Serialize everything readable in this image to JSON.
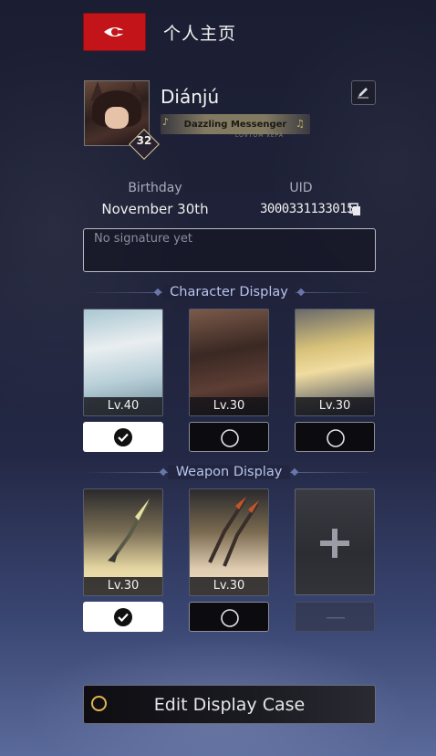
{
  "header": {
    "title": "个人主页"
  },
  "profile": {
    "username": "Diánjú",
    "level": "32",
    "title_badge": "Dazzling Messenger",
    "title_sub": "LOVTOM xEPA"
  },
  "info": {
    "birthday_label": "Birthday",
    "birthday_value": "November 30th",
    "uid_label": "UID",
    "uid_value": "3000331133015"
  },
  "signature": {
    "placeholder": "No signature yet"
  },
  "character_display": {
    "title": "Character Display",
    "cards": [
      {
        "level": "Lv.40",
        "selected": true
      },
      {
        "level": "Lv.30",
        "selected": false
      },
      {
        "level": "Lv.30",
        "selected": false
      }
    ]
  },
  "weapon_display": {
    "title": "Weapon Display",
    "cards": [
      {
        "level": "Lv.30",
        "selected": true
      },
      {
        "level": "Lv.30",
        "selected": false
      },
      {
        "level": "",
        "empty": true
      }
    ]
  },
  "edit_case": {
    "label": "Edit Display Case"
  },
  "icons": {
    "logo": "eye-emblem-icon",
    "edit": "pencil-icon",
    "copy": "copy-icon",
    "selected": "check-circle-icon",
    "unselected": "empty-circle-icon",
    "add": "plus-icon",
    "disabled": "minus-icon"
  },
  "colors": {
    "accent_red": "#c3141a",
    "section_title": "#b9c3ee",
    "gold": "#e3b64c"
  }
}
